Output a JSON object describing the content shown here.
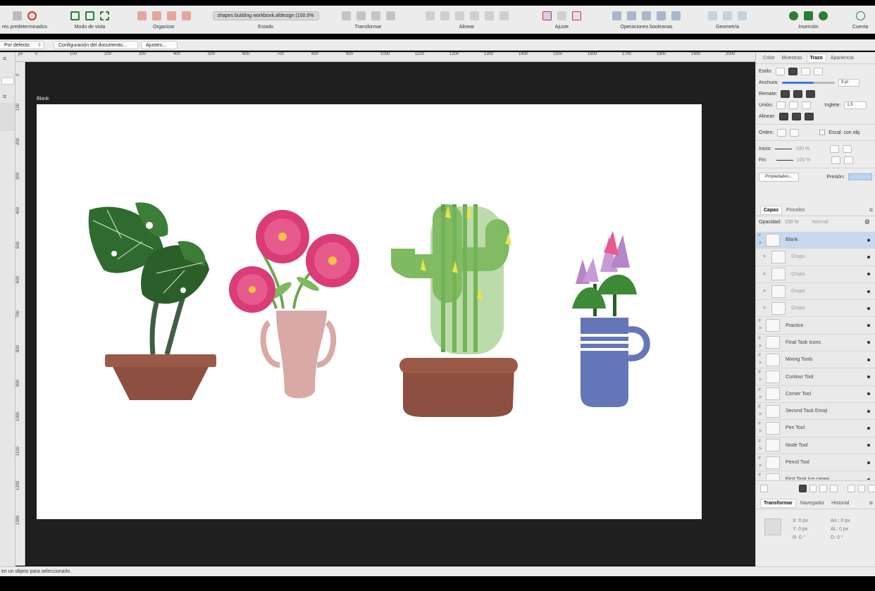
{
  "toolbar": {
    "groups": [
      {
        "label": "res predeterminados"
      },
      {
        "label": "Modo de vista"
      },
      {
        "label": "Organizar"
      },
      {
        "label": "Estado"
      },
      {
        "label": "Transformar"
      },
      {
        "label": "Alinear"
      },
      {
        "label": "Ajuste"
      },
      {
        "label": "Operaciones booleanas"
      },
      {
        "label": "Geometría"
      },
      {
        "label": "Inserción"
      },
      {
        "label": "Cuenta"
      }
    ],
    "document_title": "shapes building workbook.afdesign (150.0%"
  },
  "context_bar": {
    "preset_value": "Por defecto",
    "doc_setup_button": "Configuración del documento...",
    "adjust_button": "Ajustes..."
  },
  "ruler": {
    "unit": "px",
    "top_ticks": [
      "0",
      "100",
      "200",
      "300",
      "400",
      "500",
      "600",
      "700",
      "800",
      "900",
      "1000",
      "1100",
      "1200",
      "1300",
      "1400",
      "1500",
      "1600",
      "1700",
      "1800",
      "1900",
      "2000"
    ],
    "left_ticks": [
      "0",
      "100",
      "200",
      "300",
      "400",
      "500",
      "600",
      "700",
      "800",
      "900",
      "1000",
      "1100",
      "1200",
      "1300"
    ]
  },
  "canvas": {
    "artboard_label": "Blank"
  },
  "stroke_panel": {
    "tabs": [
      "Color",
      "Muestras",
      "Trazo",
      "Apariencia"
    ],
    "active_tab": "Trazo",
    "style_label": "Estilo:",
    "width_label": "Anchura:",
    "width_value": "9 pt",
    "cap_label": "Remate:",
    "join_label": "Unión:",
    "miter_label": "Inglete:",
    "miter_value": "1,5",
    "align_label": "Alinear:",
    "order_label": "Orden:",
    "scale_label": "Escal. con obj.",
    "start_label": "Inicio:",
    "start_pct": "100 %",
    "end_label": "Fin:",
    "end_pct": "100 %",
    "properties_button": "Propiedades...",
    "pressure_label": "Presión:"
  },
  "layers_panel": {
    "tabs": [
      "Capas",
      "Pinceles"
    ],
    "opacity_label": "Opacidad:",
    "opacity_value": "100 %",
    "blend_mode": "Normal",
    "layers": [
      {
        "name": "Blank",
        "selected": true,
        "group": false
      },
      {
        "name": "Grupo",
        "selected": false,
        "group": true
      },
      {
        "name": "Grupo",
        "selected": false,
        "group": true
      },
      {
        "name": "Grupo",
        "selected": false,
        "group": true
      },
      {
        "name": "Grupo",
        "selected": false,
        "group": true
      },
      {
        "name": "Practice",
        "selected": false,
        "group": false
      },
      {
        "name": "Final Task Icons",
        "selected": false,
        "group": false
      },
      {
        "name": "Mixing Tools",
        "selected": false,
        "group": false
      },
      {
        "name": "Contour Tool",
        "selected": false,
        "group": false
      },
      {
        "name": "Corner Tool",
        "selected": false,
        "group": false
      },
      {
        "name": "Second Task Emoji",
        "selected": false,
        "group": false
      },
      {
        "name": "Pen Tool",
        "selected": false,
        "group": false
      },
      {
        "name": "Node Tool",
        "selected": false,
        "group": false
      },
      {
        "name": "Pencil Tool",
        "selected": false,
        "group": false
      },
      {
        "name": "First Task Ice cream",
        "selected": false,
        "group": false
      }
    ]
  },
  "transform_panel": {
    "tabs": [
      "Transformar",
      "Navegador",
      "Historial"
    ],
    "x_label": "X:",
    "x_value": "0 px",
    "y_label": "Y:",
    "y_value": "0 px",
    "w_label": "An.:",
    "w_value": "0 px",
    "h_label": "Al.:",
    "h_value": "0 px",
    "r_label": "R:",
    "r_value": "0 °",
    "d_label": "D:",
    "d_value": "0 °"
  },
  "statusbar": {
    "text": "en un objeto para seleccionarlo."
  },
  "colors": {
    "canvas_bg": "#1f1f1f",
    "selection": "#c8d9ee",
    "pot_terracotta": "#9b5a48",
    "pink_vase": "#d9a9a6",
    "cactus_green": "#7fb960",
    "blue_mug": "#6476b8"
  }
}
